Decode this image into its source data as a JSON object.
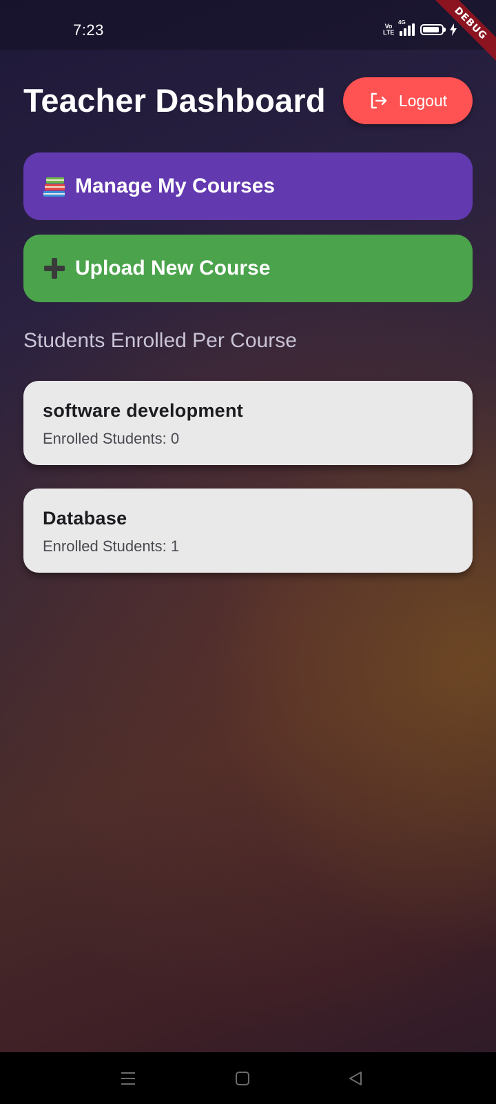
{
  "status_bar": {
    "time": "7:23",
    "volte_label": "Vo LTE",
    "network_label": "4G"
  },
  "debug_banner": "DEBUG",
  "header": {
    "title": "Teacher Dashboard",
    "logout_label": "Logout"
  },
  "actions": {
    "manage_label": "Manage My Courses",
    "manage_icon": "books-emoji",
    "upload_label": "Upload New Course",
    "upload_icon": "plus-emoji"
  },
  "section_title": "Students Enrolled Per Course",
  "courses": [
    {
      "name": "software development",
      "enrolled": "Enrolled Students: 0"
    },
    {
      "name": "Database",
      "enrolled": "Enrolled Students: 1"
    }
  ],
  "colors": {
    "logout": "#ff5252",
    "manage": "#6339b0",
    "upload": "#4ba34c",
    "card": "#eae9ea"
  }
}
